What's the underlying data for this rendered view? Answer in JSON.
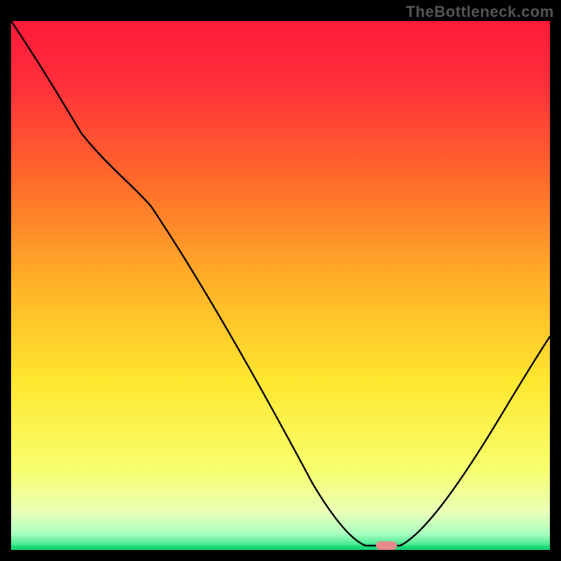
{
  "watermark": "TheBottleneck.com",
  "chart_data": {
    "type": "line",
    "title": "",
    "xlabel": "",
    "ylabel": "",
    "xlim": [
      0,
      100
    ],
    "ylim": [
      0,
      100
    ],
    "grid": false,
    "legend": false,
    "background": {
      "type": "vertical-gradient",
      "description": "red at top through orange and yellow to green at bottom",
      "stops": [
        {
          "pos": 0.0,
          "color": "#ff1a3a"
        },
        {
          "pos": 0.12,
          "color": "#ff2f3a"
        },
        {
          "pos": 0.3,
          "color": "#ff6a2b"
        },
        {
          "pos": 0.5,
          "color": "#ffb327"
        },
        {
          "pos": 0.68,
          "color": "#ffe72f"
        },
        {
          "pos": 0.85,
          "color": "#f8ff6e"
        },
        {
          "pos": 0.93,
          "color": "#e9ffb9"
        },
        {
          "pos": 0.97,
          "color": "#a8ffc0"
        },
        {
          "pos": 1.0,
          "color": "#18e07a"
        }
      ]
    },
    "series": [
      {
        "name": "bottleneck-curve",
        "stroke": "#000000",
        "x": [
          0,
          10,
          25,
          40,
          55,
          63,
          67,
          72,
          78,
          88,
          100
        ],
        "values": [
          100,
          88,
          70,
          45,
          20,
          2,
          0,
          0,
          5,
          20,
          40
        ]
      }
    ],
    "markers": [
      {
        "name": "optimal-marker",
        "shape": "rounded-rect",
        "x": 70,
        "y": 0,
        "color": "#e98a8f"
      }
    ]
  }
}
